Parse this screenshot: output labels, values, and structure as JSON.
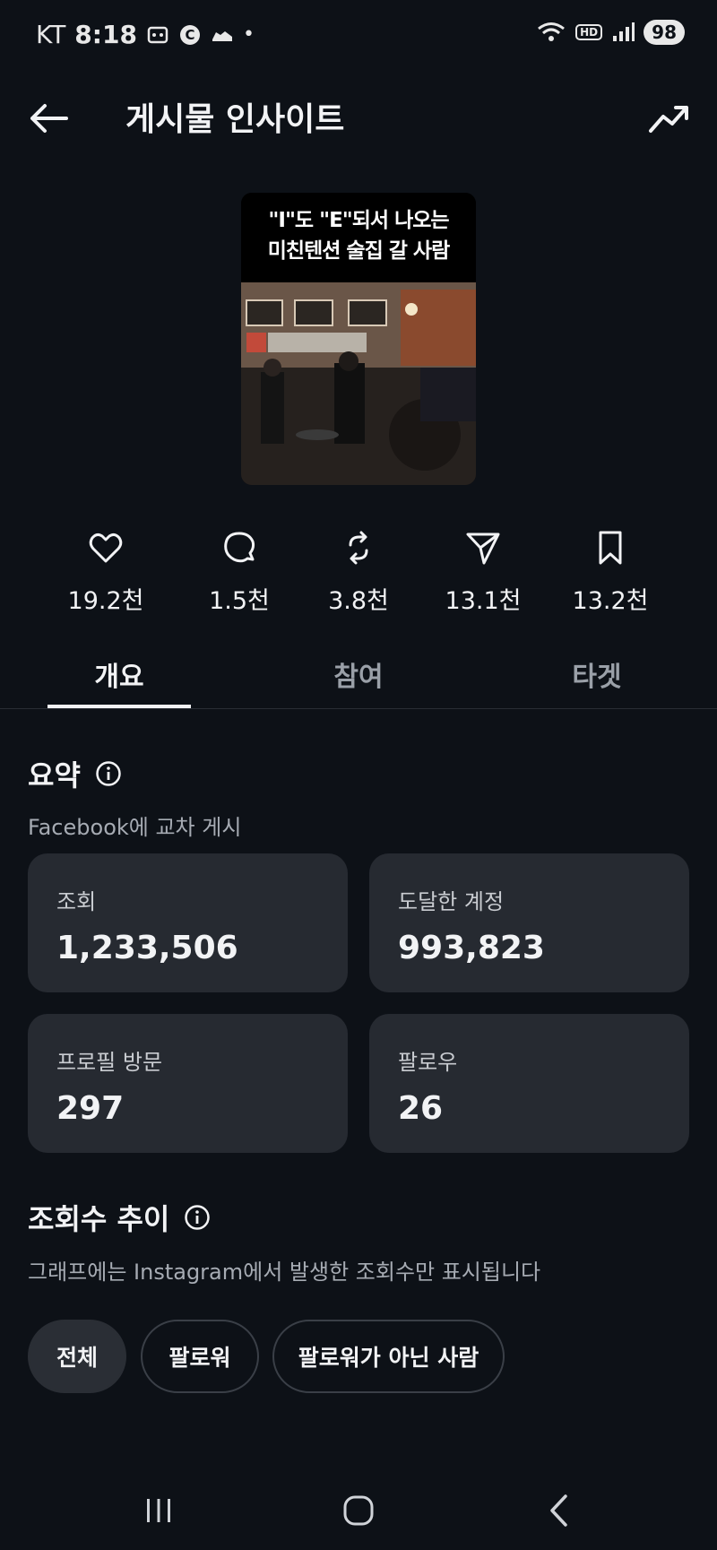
{
  "status_bar": {
    "carrier": "KT",
    "time": "8:18",
    "battery": "98",
    "hd": "HD",
    "dot": "•"
  },
  "header": {
    "title": "게시물 인사이트"
  },
  "post": {
    "caption_line1": "\"I\"도 \"E\"되서 나오는",
    "caption_line2": "미친텐션 술집 갈 사람"
  },
  "stats": [
    {
      "icon": "heart-icon",
      "value": "19.2천"
    },
    {
      "icon": "comment-icon",
      "value": "1.5천"
    },
    {
      "icon": "repost-icon",
      "value": "3.8천"
    },
    {
      "icon": "share-icon",
      "value": "13.1천"
    },
    {
      "icon": "bookmark-icon",
      "value": "13.2천"
    }
  ],
  "tabs": [
    {
      "label": "개요",
      "active": true
    },
    {
      "label": "참여",
      "active": false
    },
    {
      "label": "타겟",
      "active": false
    }
  ],
  "summary": {
    "title": "요약",
    "subtitle": "Facebook에 교차 게시",
    "cards": [
      {
        "label": "조회",
        "value": "1,233,506"
      },
      {
        "label": "도달한 계정",
        "value": "993,823"
      },
      {
        "label": "프로필 방문",
        "value": "297"
      },
      {
        "label": "팔로우",
        "value": "26"
      }
    ]
  },
  "views_trend": {
    "title": "조회수 추이",
    "subtitle": "그래프에는 Instagram에서 발생한 조회수만 표시됩니다",
    "filters": [
      {
        "label": "전체",
        "active": true
      },
      {
        "label": "팔로워",
        "active": false
      },
      {
        "label": "팔로워가 아닌 사람",
        "active": false
      }
    ]
  },
  "colors": {
    "background": "#0d1117",
    "card": "#262a31",
    "text": "#f2f3f5",
    "muted": "#a6abb3"
  }
}
